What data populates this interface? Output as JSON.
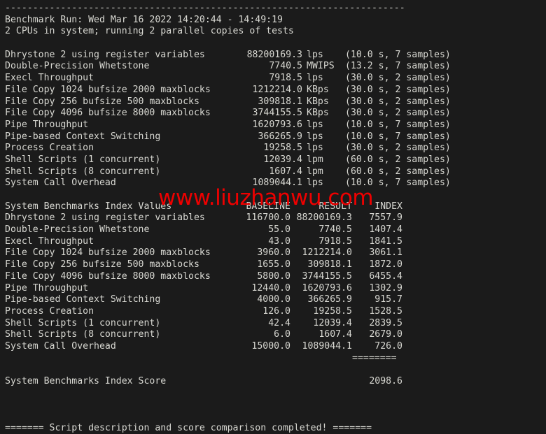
{
  "terminal": {
    "background_color": "#1b1b1b",
    "text_color": "#d8d8d2",
    "top_rule": "------------------------------------------------------------------------",
    "bottom_rule": "------------------------------------------------------------------------",
    "benchmark_run": "Benchmark Run: Wed Mar 16 2022 14:20:44 - 14:49:19",
    "cpu_info": "2 CPUs in system; running 2 parallel copies of tests",
    "footer": "======= Script description and score comparison completed! ======="
  },
  "watermark": {
    "text": "www.liuzhanwu.com",
    "color": "#ee0000"
  },
  "results": {
    "rows": [
      {
        "name": "Dhrystone 2 using register variables",
        "value": "88200169.3",
        "unit": "lps",
        "extra": "(10.0 s, 7 samples)"
      },
      {
        "name": "Double-Precision Whetstone",
        "value": "7740.5",
        "unit": "MWIPS",
        "extra": "(13.2 s, 7 samples)"
      },
      {
        "name": "Execl Throughput",
        "value": "7918.5",
        "unit": "lps",
        "extra": "(30.0 s, 2 samples)"
      },
      {
        "name": "File Copy 1024 bufsize 2000 maxblocks",
        "value": "1212214.0",
        "unit": "KBps",
        "extra": "(30.0 s, 2 samples)"
      },
      {
        "name": "File Copy 256 bufsize 500 maxblocks",
        "value": "309818.1",
        "unit": "KBps",
        "extra": "(30.0 s, 2 samples)"
      },
      {
        "name": "File Copy 4096 bufsize 8000 maxblocks",
        "value": "3744155.5",
        "unit": "KBps",
        "extra": "(30.0 s, 2 samples)"
      },
      {
        "name": "Pipe Throughput",
        "value": "1620793.6",
        "unit": "lps",
        "extra": "(10.0 s, 7 samples)"
      },
      {
        "name": "Pipe-based Context Switching",
        "value": "366265.9",
        "unit": "lps",
        "extra": "(10.0 s, 7 samples)"
      },
      {
        "name": "Process Creation",
        "value": "19258.5",
        "unit": "lps",
        "extra": "(30.0 s, 2 samples)"
      },
      {
        "name": "Shell Scripts (1 concurrent)",
        "value": "12039.4",
        "unit": "lpm",
        "extra": "(60.0 s, 2 samples)"
      },
      {
        "name": "Shell Scripts (8 concurrent)",
        "value": "1607.4",
        "unit": "lpm",
        "extra": "(60.0 s, 2 samples)"
      },
      {
        "name": "System Call Overhead",
        "value": "1089044.1",
        "unit": "lps",
        "extra": "(10.0 s, 7 samples)"
      }
    ]
  },
  "index": {
    "header": {
      "title": "System Benchmarks Index Values",
      "baseline": "BASELINE",
      "result": "RESULT",
      "index": "INDEX"
    },
    "rows": [
      {
        "name": "Dhrystone 2 using register variables",
        "baseline": "116700.0",
        "result": "88200169.3",
        "index": "7557.9"
      },
      {
        "name": "Double-Precision Whetstone",
        "baseline": "55.0",
        "result": "7740.5",
        "index": "1407.4"
      },
      {
        "name": "Execl Throughput",
        "baseline": "43.0",
        "result": "7918.5",
        "index": "1841.5"
      },
      {
        "name": "File Copy 1024 bufsize 2000 maxblocks",
        "baseline": "3960.0",
        "result": "1212214.0",
        "index": "3061.1"
      },
      {
        "name": "File Copy 256 bufsize 500 maxblocks",
        "baseline": "1655.0",
        "result": "309818.1",
        "index": "1872.0"
      },
      {
        "name": "File Copy 4096 bufsize 8000 maxblocks",
        "baseline": "5800.0",
        "result": "3744155.5",
        "index": "6455.4"
      },
      {
        "name": "Pipe Throughput",
        "baseline": "12440.0",
        "result": "1620793.6",
        "index": "1302.9"
      },
      {
        "name": "Pipe-based Context Switching",
        "baseline": "4000.0",
        "result": "366265.9",
        "index": "915.7"
      },
      {
        "name": "Process Creation",
        "baseline": "126.0",
        "result": "19258.5",
        "index": "1528.5"
      },
      {
        "name": "Shell Scripts (1 concurrent)",
        "baseline": "42.4",
        "result": "12039.4",
        "index": "2839.5"
      },
      {
        "name": "Shell Scripts (8 concurrent)",
        "baseline": "6.0",
        "result": "1607.4",
        "index": "2679.0"
      },
      {
        "name": "System Call Overhead",
        "baseline": "15000.0",
        "result": "1089044.1",
        "index": "726.0"
      }
    ],
    "separator": "========",
    "score_label": "System Benchmarks Index Score",
    "score_value": "2098.6"
  }
}
